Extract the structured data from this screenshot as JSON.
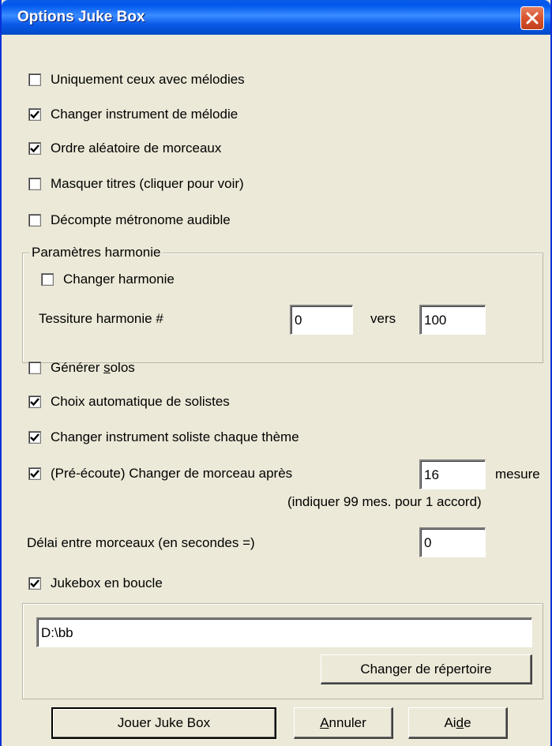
{
  "window": {
    "title": "Options Juke Box"
  },
  "checkboxes": {
    "melodies_only": {
      "label": "Uniquement ceux avec mélodies",
      "checked": false
    },
    "change_melody_instrument": {
      "label": "Changer instrument de mélodie",
      "checked": true
    },
    "random_order": {
      "label": "Ordre aléatoire de morceaux",
      "checked": true
    },
    "hide_titles": {
      "label": "Masquer titres (cliquer pour voir)",
      "checked": false
    },
    "audible_count_in": {
      "label": "Décompte métronome audible",
      "checked": false
    },
    "generate_solos_pre": "Générer ",
    "generate_solos_underline": "s",
    "generate_solos_post": "olos",
    "generate_solos_checked": false,
    "auto_soloists": {
      "label": "Choix automatique de solistes",
      "checked": true
    },
    "change_soloist_instrument": {
      "label": "Changer instrument soliste chaque thème",
      "checked": true
    },
    "preview_change": {
      "label": "(Pré-écoute) Changer de morceau après",
      "checked": true
    },
    "loop_jukebox": {
      "label": "Jukebox en boucle",
      "checked": true
    }
  },
  "harmony": {
    "group_title": "Paramètres harmonie",
    "change_harmony": {
      "label": "Changer harmonie",
      "checked": false
    },
    "range_label": "Tessiture harmonie #",
    "range_from": "0",
    "range_to_label": "vers",
    "range_to": "100"
  },
  "preview": {
    "bars_value": "16",
    "bars_unit": "mesure",
    "hint": "(indiquer 99 mes. pour 1 accord)"
  },
  "delay": {
    "label": "Délai entre morceaux (en secondes =)",
    "value": "0"
  },
  "folder": {
    "path": "D:\\bb",
    "change_button": "Changer de répertoire"
  },
  "buttons": {
    "play": "Jouer Juke Box",
    "cancel_underline": "A",
    "cancel_rest": "nnuler",
    "help_pre": "Ai",
    "help_underline": "d",
    "help_post": "e"
  }
}
